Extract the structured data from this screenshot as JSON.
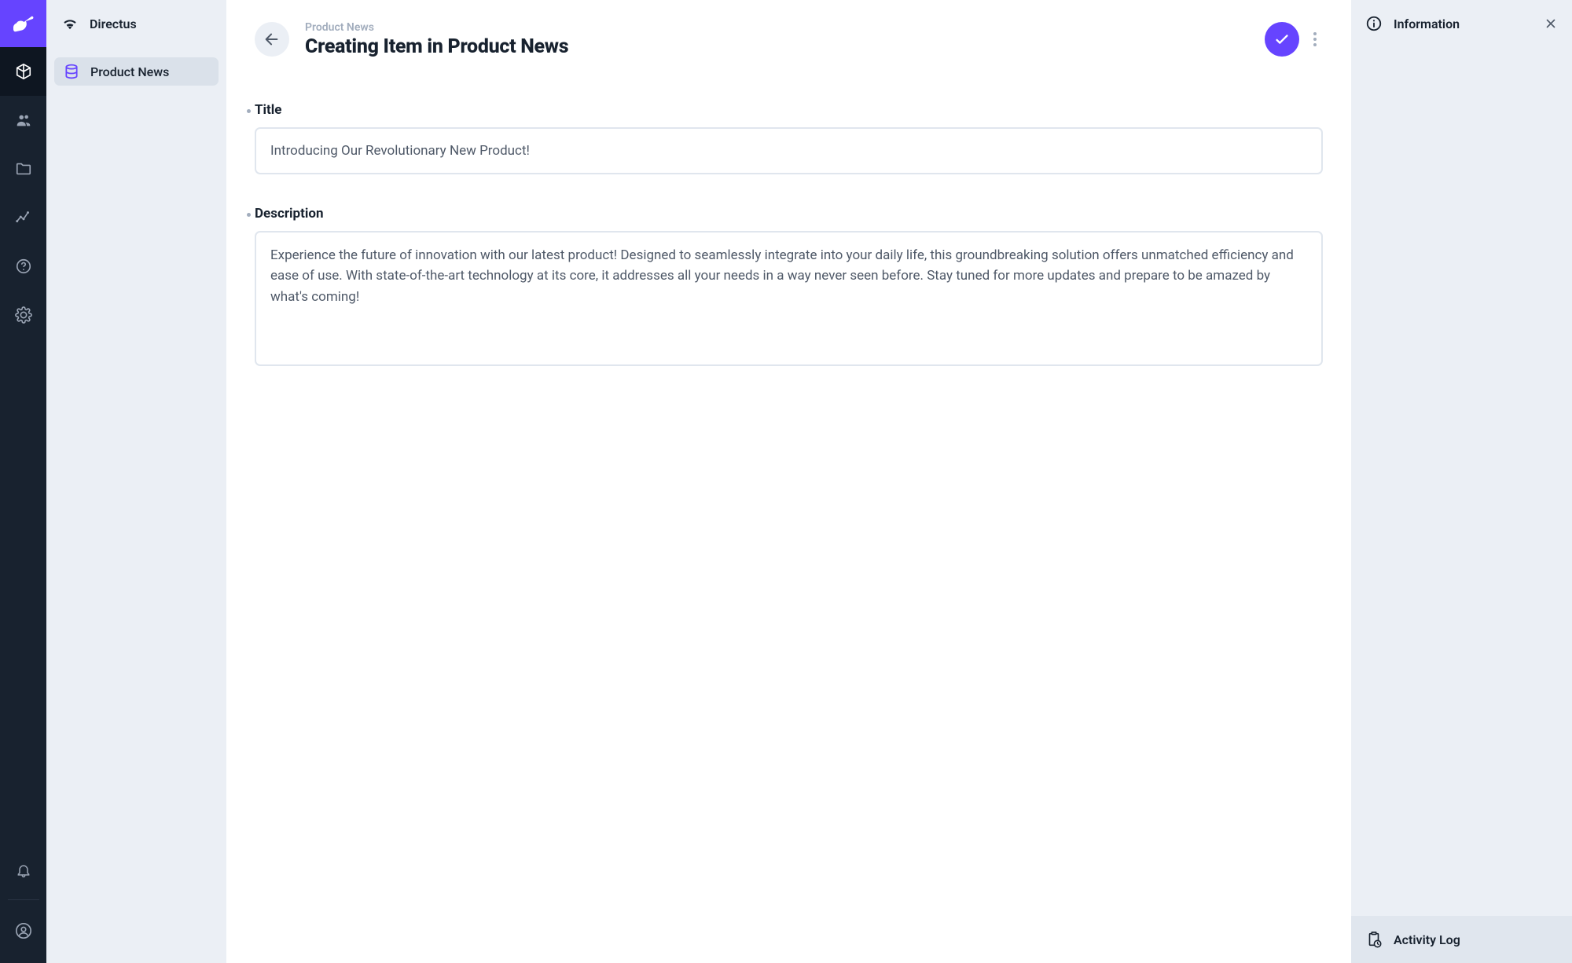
{
  "app_name": "Directus",
  "sidebar": {
    "collection_label": "Product News"
  },
  "header": {
    "breadcrumb": "Product News",
    "title": "Creating Item in Product News"
  },
  "fields": {
    "title": {
      "label": "Title",
      "value": "Introducing Our Revolutionary New Product!"
    },
    "description": {
      "label": "Description",
      "value": "Experience the future of innovation with our latest product! Designed to seamlessly integrate into your daily life, this groundbreaking solution offers unmatched efficiency and ease of use. With state-of-the-art technology at its core, it addresses all your needs in a way never seen before. Stay tuned for more updates and prepare to be amazed by what's coming!"
    }
  },
  "info_panel": {
    "title": "Information",
    "footer_label": "Activity Log"
  }
}
